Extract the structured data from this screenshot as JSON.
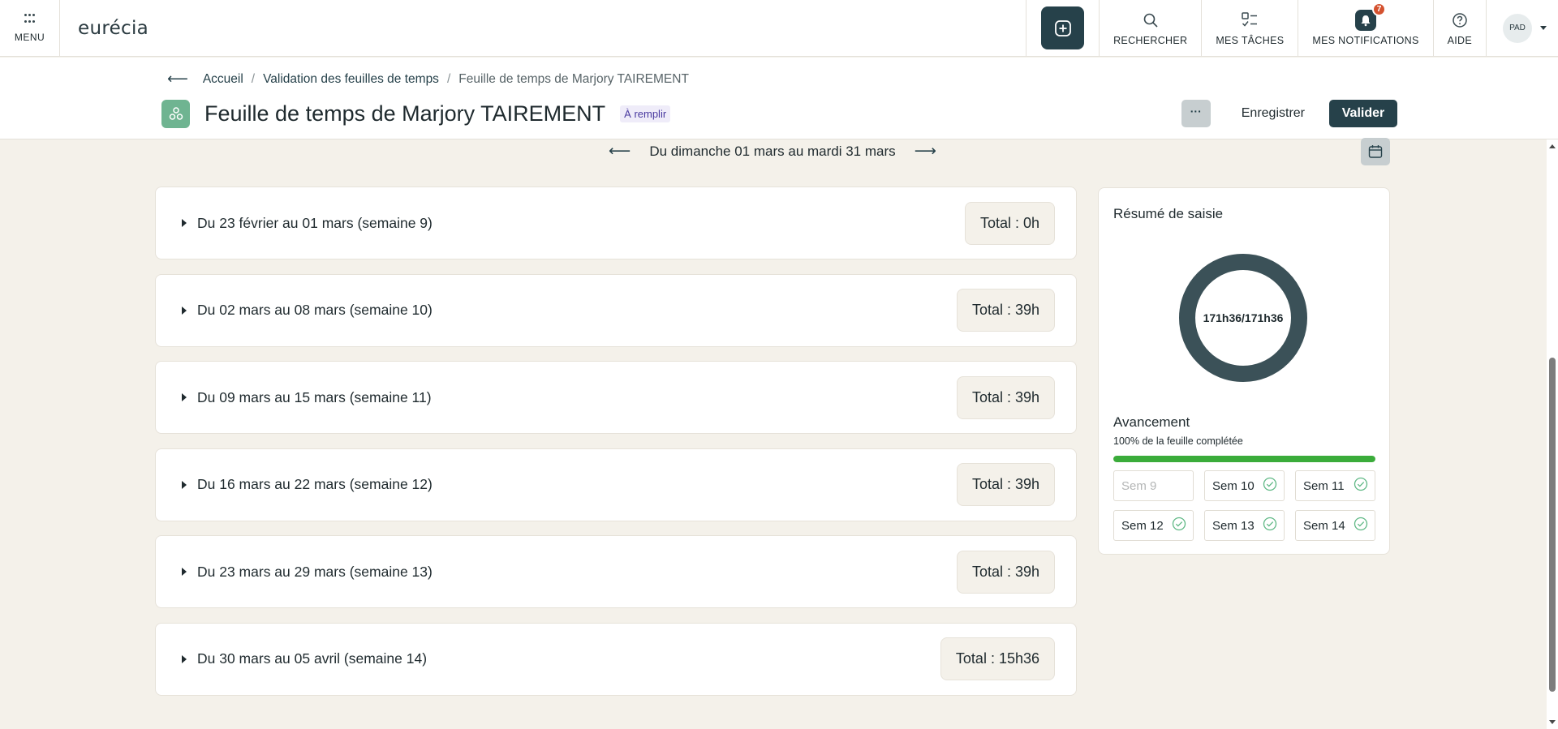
{
  "topbar": {
    "menu_label": "MENU",
    "logo_text": "eurécia",
    "tools": [
      {
        "label": "RECHERCHER",
        "icon": "search-icon"
      },
      {
        "label": "MES TÂCHES",
        "icon": "tasks-icon"
      },
      {
        "label": "MES NOTIFICATIONS",
        "icon": "bell-icon",
        "badge": "7"
      },
      {
        "label": "AIDE",
        "icon": "help-icon"
      }
    ],
    "avatar_initials": "PAD"
  },
  "breadcrumb": {
    "items": [
      "Accueil",
      "Validation des feuilles de temps"
    ],
    "current": "Feuille de temps de Marjory TAIREMENT"
  },
  "header": {
    "title": "Feuille de temps de Marjory TAIREMENT",
    "status": "À remplir",
    "more_label": "···",
    "save_label": "Enregistrer",
    "validate_label": "Valider"
  },
  "period": {
    "label": "Du dimanche 01 mars au mardi 31 mars",
    "prev": "⟵",
    "next": "⟶"
  },
  "weeks": [
    {
      "label": "Du 23 février au 01 mars (semaine 9)",
      "total": "Total : 0h"
    },
    {
      "label": "Du 02 mars au 08 mars (semaine 10)",
      "total": "Total : 39h"
    },
    {
      "label": "Du 09 mars au 15 mars (semaine 11)",
      "total": "Total : 39h"
    },
    {
      "label": "Du 16 mars au 22 mars (semaine 12)",
      "total": "Total : 39h"
    },
    {
      "label": "Du 23 mars au 29 mars (semaine 13)",
      "total": "Total : 39h"
    },
    {
      "label": "Du 30 mars au 05 avril (semaine 14)",
      "total": "Total : 15h36"
    }
  ],
  "summary": {
    "title": "Résumé de saisie",
    "donut_label": "171h36/171h36",
    "donut_fraction": 1.0,
    "progress_title": "Avancement",
    "progress_text": "100% de la feuille complétée",
    "progress_fraction": 1.0,
    "chips": [
      {
        "label": "Sem 9",
        "done": false
      },
      {
        "label": "Sem 10",
        "done": true
      },
      {
        "label": "Sem 11",
        "done": true
      },
      {
        "label": "Sem 12",
        "done": true
      },
      {
        "label": "Sem 13",
        "done": true
      },
      {
        "label": "Sem 14",
        "done": true
      }
    ]
  },
  "colors": {
    "primary": "#26414a",
    "background": "#f4f1ea",
    "progress": "#3aac3a",
    "status_badge_bg": "#efecf9",
    "status_badge_text": "#4a3aa0",
    "notification_badge": "#d4522f",
    "check": "#5fb885"
  }
}
